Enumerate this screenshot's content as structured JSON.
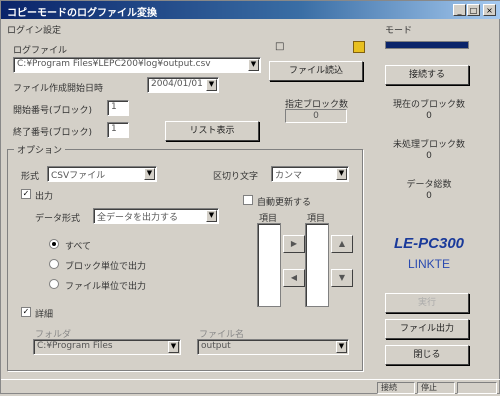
{
  "window": {
    "title": "コピーモードのログファイル変換",
    "minimize": "_",
    "maximize": "□",
    "close": "×"
  },
  "main": {
    "group_title": "ログイン設定",
    "log_file_label": "ログファイル",
    "log_file_value": "C:¥Program Files¥LEPC200¥log¥output.csv",
    "refresh_button": "ファイル読込",
    "start_date_label": "ファイル作成開始日時",
    "start_date_value": "2004/01/01",
    "start_number_label": "開始番号(ブロック)",
    "start_number_value": "1",
    "end_number_label": "終了番号(ブロック)",
    "end_number_value": "1",
    "list_button": "リスト表示",
    "record_count_label": "指定ブロック数",
    "record_count_value": "0"
  },
  "options": {
    "title": "オプション",
    "format_label": "形式",
    "format_value": "CSVファイル",
    "delimiter_label": "区切り文字",
    "delimiter_value": "カンマ",
    "output_check_label": "出力",
    "data_type_label": "データ形式",
    "data_type_value": "全データを出力する",
    "auto_check_label": "自動更新する",
    "radios": [
      "すべて",
      "ブロック単位で出力",
      "ファイル単位で出力"
    ],
    "col1_label": "項目",
    "col2_label": "項目",
    "extra_check_label": "詳細",
    "folder_label": "フォルダ",
    "folder_value": "C:¥Program Files",
    "file_label": "ファイル名",
    "file_value": "output"
  },
  "side": {
    "group_title": "モード",
    "connect_button": "接続する",
    "stat1_label": "現在のブロック数",
    "stat1_value": "0",
    "stat2_label": "未処理ブロック数",
    "stat2_value": "0",
    "stat3_label": "データ総数",
    "stat3_value": "0",
    "logo_line1": "LE-PC300",
    "logo_line2": "LINKTE",
    "run_button": "実行",
    "settings_button": "ファイル出力",
    "close_button": "閉じる"
  },
  "status": {
    "cell1": "接続",
    "cell2": "停止",
    "cell3": ""
  }
}
